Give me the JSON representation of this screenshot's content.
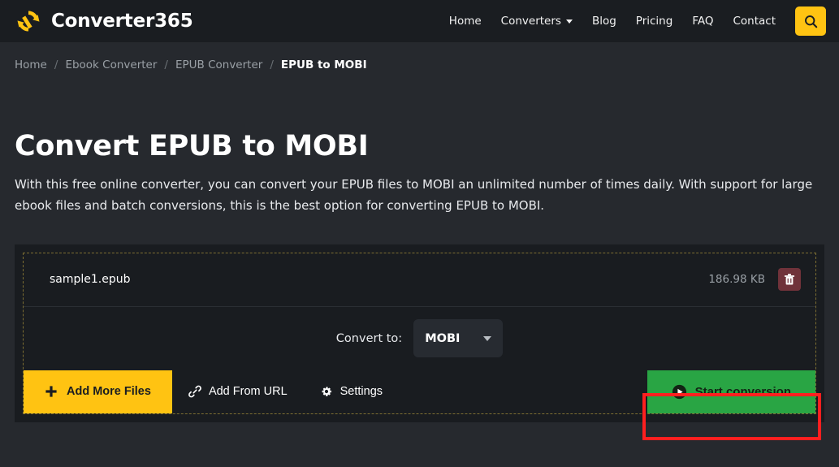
{
  "header": {
    "brand_name": "Converter365",
    "logo_icon": "refresh-arrows-icon",
    "nav": [
      {
        "label": "Home",
        "has_caret": false
      },
      {
        "label": "Converters",
        "has_caret": true
      },
      {
        "label": "Blog",
        "has_caret": false
      },
      {
        "label": "Pricing",
        "has_caret": false
      },
      {
        "label": "FAQ",
        "has_caret": false
      },
      {
        "label": "Contact",
        "has_caret": false
      }
    ],
    "search_icon": "search-icon"
  },
  "breadcrumb": {
    "items": [
      {
        "label": "Home"
      },
      {
        "label": "Ebook Converter"
      },
      {
        "label": "EPUB Converter"
      },
      {
        "label": "EPUB to MOBI"
      }
    ],
    "separator": "/"
  },
  "main": {
    "title": "Convert EPUB to MOBI",
    "description": "With this free online converter, you can convert your EPUB files to MOBI an unlimited number of times daily. With support for large ebook files and batch conversions, this is the best option for converting EPUB to MOBI."
  },
  "converter": {
    "file": {
      "name": "sample1.epub",
      "size": "186.98 KB",
      "delete_icon": "trash-icon"
    },
    "convert_to_label": "Convert to:",
    "target_format": "MOBI",
    "format_caret_icon": "chevron-down-icon",
    "actions": {
      "add_more_files": {
        "label": "Add More Files",
        "icon": "plus-icon"
      },
      "add_from_url": {
        "label": "Add From URL",
        "icon": "link-icon"
      },
      "settings": {
        "label": "Settings",
        "icon": "gear-icon"
      },
      "start_conversion": {
        "label": "Start conversion",
        "icon": "play-circle-icon"
      }
    }
  },
  "colors": {
    "page_bg": "#26292e",
    "header_bg": "#1a1d21",
    "card_bg": "#191c20",
    "accent_yellow": "#ffc312",
    "success_green": "#29a544",
    "danger_red": "#70323a",
    "dashed_border": "#7d6e32",
    "highlight_red": "#ff1f1f"
  }
}
